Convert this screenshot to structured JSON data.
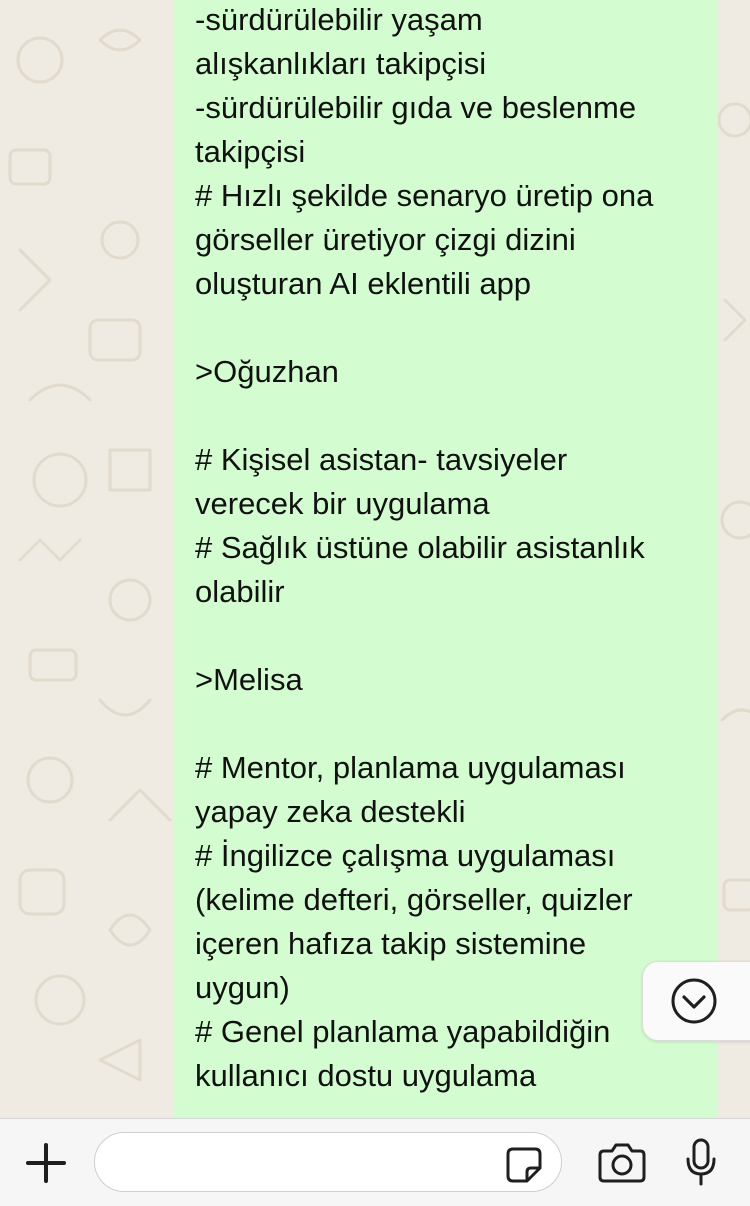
{
  "chat": {
    "message": {
      "lines": [
        "-sürdürülebilir yaşam",
        "alışkanlıkları takipçisi",
        "-sürdürülebilir gıda ve beslenme",
        "takipçisi",
        "# Hızlı şekilde senaryo üretip ona",
        "görseller üretiyor çizgi dizini",
        "oluşturan AI eklentili app",
        "",
        ">Oğuzhan",
        "",
        "# Kişisel asistan- tavsiyeler",
        "verecek bir uygulama",
        "# Sağlık üstüne olabilir asistanlık",
        "olabilir",
        "",
        ">Melisa",
        "",
        "# Mentor, planlama uygulaması",
        "yapay zeka destekli",
        "# İngilizce çalışma uygulaması",
        "(kelime defteri, görseller, quizler",
        "içeren hafıza takip sistemine",
        "uygun)",
        "# Genel planlama yapabildiğin",
        "kullanıcı dostu uygulama"
      ]
    },
    "scroll_button_icon": "chevron-down-circle-icon"
  },
  "composer": {
    "input_value": "",
    "input_placeholder": "",
    "icons": [
      "plus-icon",
      "sticker-icon",
      "camera-icon",
      "microphone-icon"
    ]
  },
  "colors": {
    "bubble_background": "#d3fdd0",
    "wallpaper": "#efeae2",
    "composer_background": "#f6f6f6",
    "text": "#111111"
  }
}
